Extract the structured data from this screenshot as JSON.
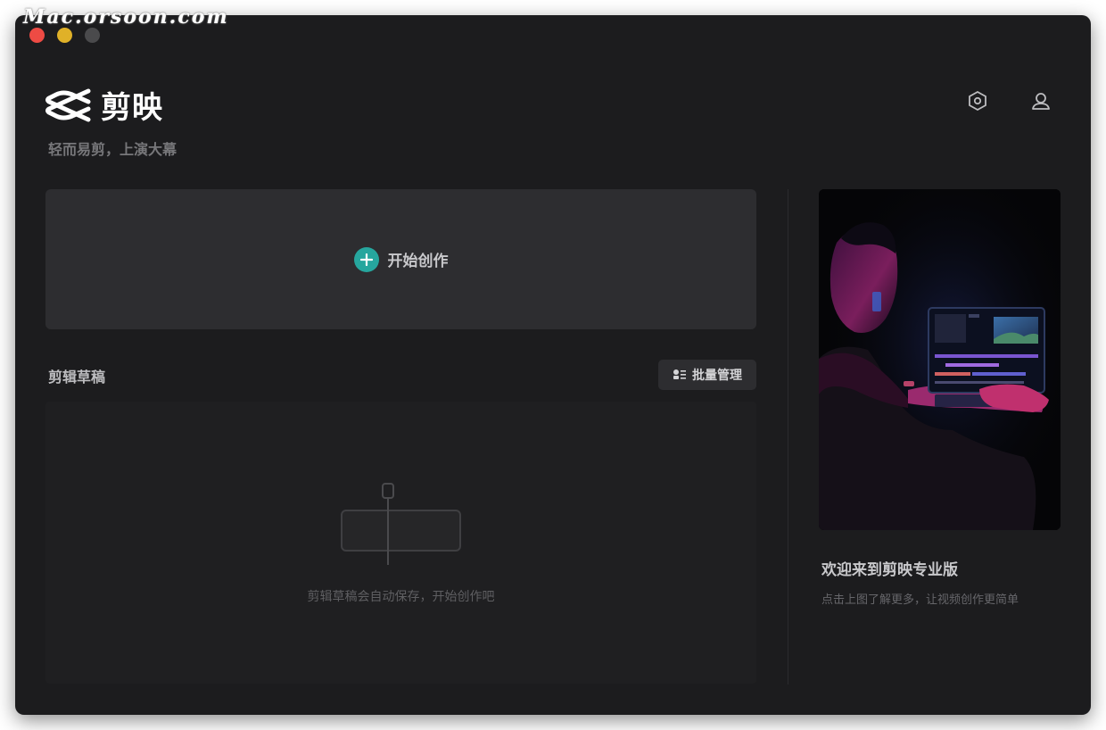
{
  "watermark": "Mac.orsoon.com",
  "app": {
    "name": "剪映",
    "tagline": "轻而易剪，上演大幕"
  },
  "header": {
    "icons": [
      "settings-hexagon-icon",
      "account-user-icon"
    ]
  },
  "create": {
    "label": "开始创作",
    "icon": "plus-icon",
    "accent": "#26a69e"
  },
  "drafts": {
    "title": "剪辑草稿",
    "batch_label": "批量管理",
    "empty_text": "剪辑草稿会自动保存，开始创作吧"
  },
  "promo": {
    "title": "欢迎来到剪映专业版",
    "subtitle": "点击上图了解更多，让视频创作更简单"
  },
  "colors": {
    "window_bg": "#1c1c1e",
    "card_bg": "#2d2d30",
    "accent": "#26a69e",
    "traffic_close": "#ee4b44",
    "traffic_min": "#e0b128"
  }
}
